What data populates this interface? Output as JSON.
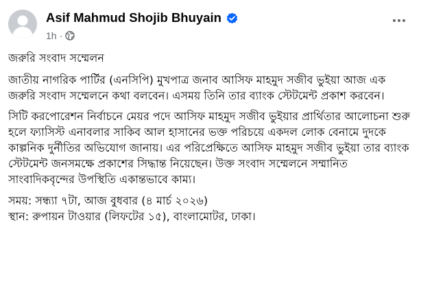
{
  "post": {
    "author_name": "Asif Mahmud Shojib Bhuyain",
    "verified_icon": "verified-badge-icon",
    "timestamp": "1h",
    "separator": "·",
    "audience_icon": "globe-icon",
    "more_icon": "more-options-icon",
    "colors": {
      "verified": "#0866ff",
      "secondary_text": "#65676b",
      "primary_text": "#080809",
      "avatar_bg": "#c9ccd1"
    },
    "paragraphs": [
      "জরুরি সংবাদ সম্মেলন",
      "জাতীয় নাগরিক পার্টির (এনসিপি) মুখপাত্র জনাব আসিফ মাহমুদ সজীব ভুইয়া আজ এক জরুরি সংবাদ সম্মেলনে কথা বলবেন। এসময় তিনি তার ব্যাংক স্টেটমেন্ট প্রকাশ করবেন।",
      "সিটি করপোরেশন নির্বাচনে মেয়র পদে আসিফ মাহমুদ সজীব ভুইয়ার প্রার্থিতার আলোচনা শুরু হলে ফ্যাসিস্ট এনাবলার সাকিব আল হাসানের ভক্ত পরিচয়ে একদল লোক বেনামে দুদকে কাল্পনিক দুর্নীতির অভিযোগ জানায়। এর পরিপ্রেক্ষিতে আসিফ মাহমুদ সজীব ভুইয়া তার ব্যাংক স্টেটমেন্ট জনসমক্ষে প্রকাশের সিদ্ধান্ত নিয়েছেন। উক্ত সংবাদ সম্মেলনে সম্মানিত সাংবাদিকবৃন্দের উপস্থিতি একান্তভাবে কাম্য।",
      "সময়: সন্ধ্যা ৭টা, আজ বুধবার (৪ মার্চ ২০২৬)",
      "স্থান: রুপায়ন টাওয়ার (লিফটের ১৫), বাংলামোটর, ঢাকা।"
    ]
  }
}
